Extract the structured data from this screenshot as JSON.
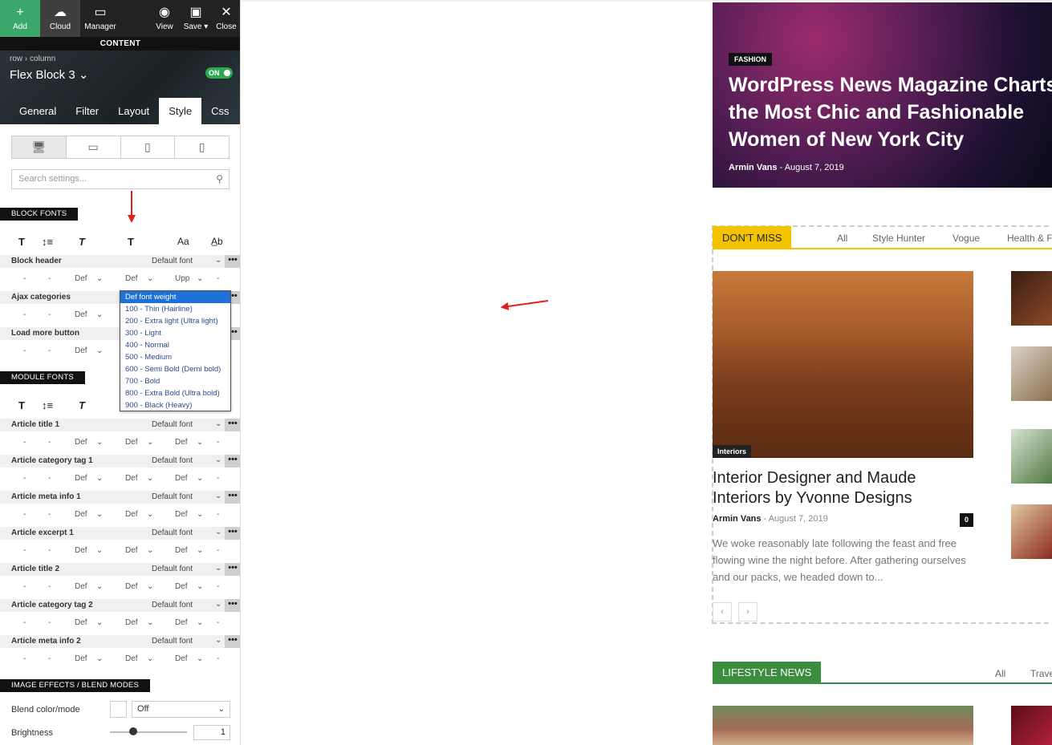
{
  "toolbar": {
    "add": "Add",
    "cloud": "Cloud",
    "manager": "Manager",
    "view": "View",
    "save": "Save ▾",
    "close": "Close"
  },
  "content_bar": "CONTENT",
  "header": {
    "crumb_row": "row",
    "crumb_sep": "›",
    "crumb_column": "column",
    "block": "Flex Block 3 ⌄",
    "toggle": "ON"
  },
  "tabs": [
    "General",
    "Filter",
    "Layout",
    "Style",
    "Css"
  ],
  "active_tab": "Style",
  "search_placeholder": "Search settings...",
  "block_fonts_label": "BLOCK FONTS",
  "module_fonts_label": "MODULE FONTS",
  "image_effects_label": "IMAGE EFFECTS / BLEND MODES",
  "icons": {
    "size": "T",
    "line": "↕≡",
    "style": "T",
    "weight": "T",
    "transform": "Aa",
    "spacing": "A̲b"
  },
  "block_rows": [
    {
      "name": "Block header",
      "font": "Default font",
      "vals": [
        "-",
        "-",
        "Def",
        "Def",
        "Upp",
        "-"
      ]
    },
    {
      "name": "Ajax categories",
      "font": "",
      "vals": [
        "-",
        "-",
        "Def"
      ]
    },
    {
      "name": "Load more button",
      "font": "",
      "vals": [
        "-",
        "-",
        "Def"
      ]
    }
  ],
  "module_rows": [
    {
      "name": "Article title 1",
      "font": "Default font",
      "vals": [
        "-",
        "-",
        "Def",
        "Def",
        "Def",
        "-"
      ]
    },
    {
      "name": "Article category tag 1",
      "font": "Default font",
      "vals": [
        "-",
        "-",
        "Def",
        "Def",
        "Def",
        "-"
      ]
    },
    {
      "name": "Article meta info 1",
      "font": "Default font",
      "vals": [
        "-",
        "-",
        "Def",
        "Def",
        "Def",
        "-"
      ]
    },
    {
      "name": "Article excerpt 1",
      "font": "Default font",
      "vals": [
        "-",
        "-",
        "Def",
        "Def",
        "Def",
        "-"
      ]
    },
    {
      "name": "Article title 2",
      "font": "Default font",
      "vals": [
        "-",
        "-",
        "Def",
        "Def",
        "Def",
        "-"
      ]
    },
    {
      "name": "Article category tag 2",
      "font": "Default font",
      "vals": [
        "-",
        "-",
        "Def",
        "Def",
        "Def",
        "-"
      ]
    },
    {
      "name": "Article meta info 2",
      "font": "Default font",
      "vals": [
        "-",
        "-",
        "Def",
        "Def",
        "Def",
        "-"
      ]
    }
  ],
  "dots": "•••",
  "font_weight_options": [
    "Def font weight",
    "100 - Thin (Hairline)",
    "200 - Extra light (Ultra light)",
    "300 - Light",
    "400 - Normal",
    "500 - Medium",
    "600 - Semi Bold (Demi bold)",
    "700 - Bold",
    "800 - Extra Bold (Ultra bold)",
    "900 - Black (Heavy)"
  ],
  "blend": {
    "label": "Blend color/mode",
    "value": "Off",
    "brightness_label": "Brightness",
    "brightness_value": "1",
    "brightness_level": 0.3
  },
  "site": {
    "hero": {
      "category": "FASHION",
      "title": "WordPress News Magazine Charts the Most Chic and Fashionable Women of New York City",
      "author": "Armin Vans",
      "date": "August 7, 2019"
    },
    "dont_miss": {
      "label": "DON'T MISS",
      "tabs": [
        "All",
        "Style Hunter",
        "Vogue",
        "Health & F"
      ],
      "tag": "Interiors",
      "title": "Interior Designer and Maude Interiors by Yvonne Designs",
      "author": "Armin Vans",
      "date": "August 7, 2019",
      "comments": "0",
      "excerpt": "We woke reasonably late following the feast and free flowing wine the night before. After gathering ourselves and our packs, we headed down to..."
    },
    "lifestyle": {
      "label": "LIFESTYLE NEWS",
      "tabs": [
        "All",
        "Trave"
      ]
    }
  },
  "colors": {
    "accent_green": "#3aa86a",
    "dont_miss_yellow": "#f3c300",
    "lifestyle_green": "#3c8d3f",
    "dropdown_selected": "#1e6fd6",
    "annotation_red": "#e02020"
  }
}
